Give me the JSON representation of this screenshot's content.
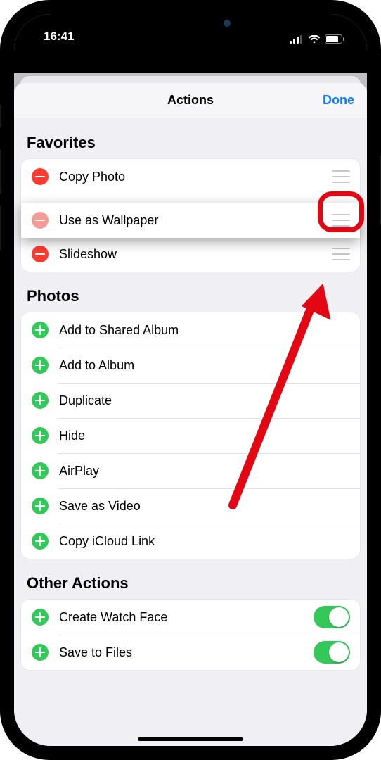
{
  "status": {
    "time": "16:41"
  },
  "nav": {
    "title": "Actions",
    "done": "Done"
  },
  "sections": {
    "favorites": {
      "title": "Favorites",
      "items": [
        {
          "label": "Copy Photo"
        },
        {
          "label": "Use as Wallpaper"
        },
        {
          "label": "Slideshow"
        }
      ]
    },
    "photos": {
      "title": "Photos",
      "items": [
        {
          "label": "Add to Shared Album"
        },
        {
          "label": "Add to Album"
        },
        {
          "label": "Duplicate"
        },
        {
          "label": "Hide"
        },
        {
          "label": "AirPlay"
        },
        {
          "label": "Save as Video"
        },
        {
          "label": "Copy iCloud Link"
        }
      ]
    },
    "other": {
      "title": "Other Actions",
      "items": [
        {
          "label": "Create Watch Face"
        },
        {
          "label": "Save to Files"
        }
      ]
    }
  }
}
